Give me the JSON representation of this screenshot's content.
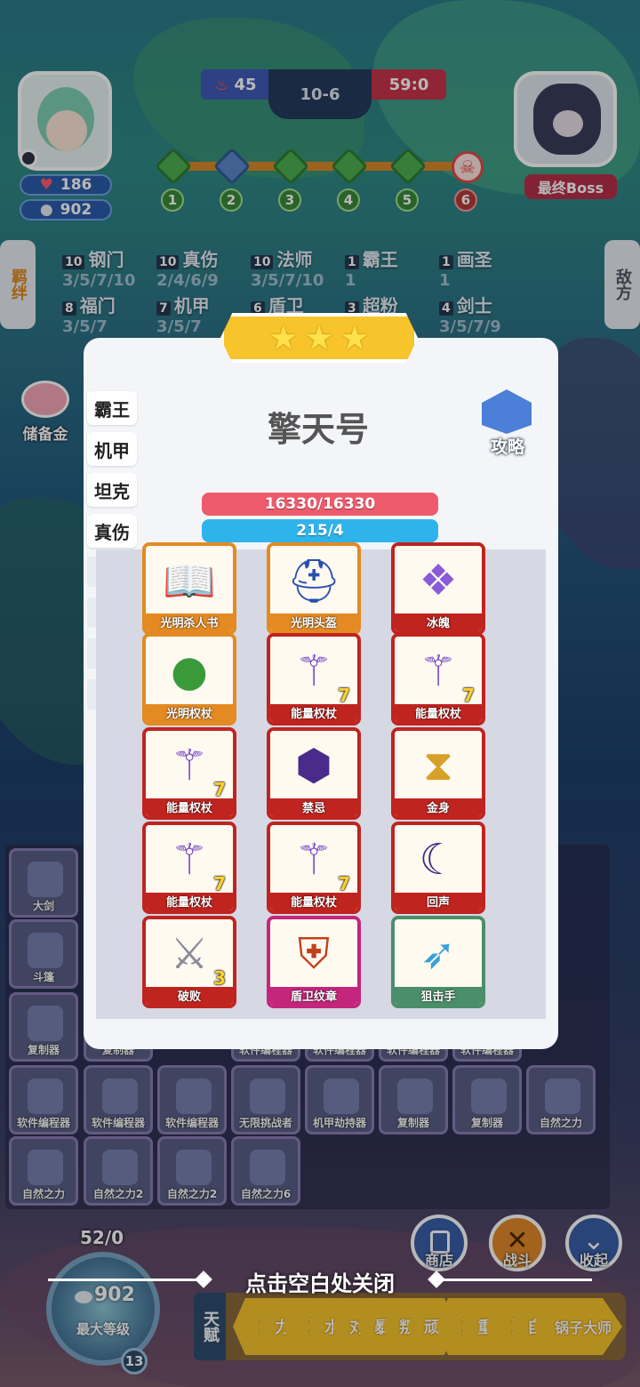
{
  "hud": {
    "hp": "186",
    "gold": "902",
    "score_left": "45",
    "round": "10-6",
    "score_right": "59:0",
    "boss_label": "最终Boss",
    "stages": [
      "1",
      "2",
      "3",
      "4",
      "5",
      "6"
    ]
  },
  "side_tabs": {
    "left": "羁绊",
    "right": "敌方"
  },
  "synergies": [
    {
      "count": "10",
      "name": "钢门",
      "steps": "3/5/7/10"
    },
    {
      "count": "10",
      "name": "真伤",
      "steps": "2/4/6/9"
    },
    {
      "count": "10",
      "name": "法师",
      "steps": "3/5/7/10"
    },
    {
      "count": "1",
      "name": "霸王",
      "steps": "1"
    },
    {
      "count": "1",
      "name": "画圣",
      "steps": "1"
    },
    {
      "count": "8",
      "name": "福门",
      "steps": "3/5/7"
    },
    {
      "count": "7",
      "name": "机甲",
      "steps": "3/5/7"
    },
    {
      "count": "6",
      "name": "盾卫",
      "steps": ""
    },
    {
      "count": "3",
      "name": "超粉",
      "steps": ""
    },
    {
      "count": "4",
      "name": "剑士",
      "steps": "3/5/7/9"
    }
  ],
  "piggy_label": "储备金",
  "unit_panel": {
    "name": "擎天号",
    "guide_label": "攻略",
    "hp_text": "16330/16330",
    "mana_text": "215/4",
    "classes": [
      "霸王",
      "机甲",
      "坦克",
      "真伤"
    ],
    "items": [
      {
        "label": "光明杀人书",
        "count": "",
        "rarity": "orange",
        "icon": "book-icon"
      },
      {
        "label": "光明头盔",
        "count": "",
        "rarity": "orange",
        "icon": "helmet-icon"
      },
      {
        "label": "冰魄",
        "count": "",
        "rarity": "red",
        "icon": "crystal-icon"
      },
      {
        "label": "光明权杖",
        "count": "",
        "rarity": "orange",
        "icon": "orb-icon"
      },
      {
        "label": "能量权杖",
        "count": "7",
        "rarity": "red",
        "icon": "scepter-icon"
      },
      {
        "label": "能量权杖",
        "count": "7",
        "rarity": "red",
        "icon": "scepter-icon"
      },
      {
        "label": "能量权杖",
        "count": "7",
        "rarity": "red",
        "icon": "scepter-icon"
      },
      {
        "label": "禁忌",
        "count": "",
        "rarity": "red",
        "icon": "gem-icon"
      },
      {
        "label": "金身",
        "count": "",
        "rarity": "red",
        "icon": "hourglass-icon"
      },
      {
        "label": "能量权杖",
        "count": "7",
        "rarity": "red",
        "icon": "scepter-icon"
      },
      {
        "label": "能量权杖",
        "count": "7",
        "rarity": "red",
        "icon": "scepter-icon"
      },
      {
        "label": "回声",
        "count": "",
        "rarity": "red",
        "icon": "moon-staff-icon"
      },
      {
        "label": "破败",
        "count": "3",
        "rarity": "red",
        "icon": "sword-icon"
      },
      {
        "label": "盾卫纹章",
        "count": "",
        "rarity": "pink",
        "icon": "emblem-icon"
      },
      {
        "label": "狙击手",
        "count": "",
        "rarity": "green",
        "icon": "rifle-icon"
      }
    ]
  },
  "close_hint": "点击空白处关闭",
  "bottom": {
    "level_progress": "52/0",
    "coin": "902",
    "level_label": "最大等级",
    "level_badge": "13",
    "shop_label": "商店",
    "battle_label": "战斗",
    "collapse_label": "收起",
    "talent_tab": "天赋",
    "talents": [
      "【",
      "力",
      "【",
      "水",
      "对",
      "暴",
      "叛",
      "顽",
      "【",
      "重",
      "【",
      "自",
      "变",
      "锅子大师"
    ]
  },
  "grid_items": [
    {
      "label": "大剑"
    },
    {
      "label": "斗篷"
    },
    {
      "label": "复制器"
    },
    {
      "label": "复制器"
    },
    {
      "label": "软件编程器"
    },
    {
      "label": "软件编程器"
    },
    {
      "label": "软件编程器"
    },
    {
      "label": "软件编程器"
    },
    {
      "label": "软件编程器"
    },
    {
      "label": "软件编程器"
    },
    {
      "label": "软件编程器"
    },
    {
      "label": "无限挑战者"
    },
    {
      "label": "机甲劫持器"
    },
    {
      "label": "复制器"
    },
    {
      "label": "复制器"
    },
    {
      "label": "自然之力"
    },
    {
      "label": "自然之力"
    },
    {
      "label": "自然之力2"
    },
    {
      "label": "自然之力2"
    },
    {
      "label": "自然之力6"
    }
  ]
}
